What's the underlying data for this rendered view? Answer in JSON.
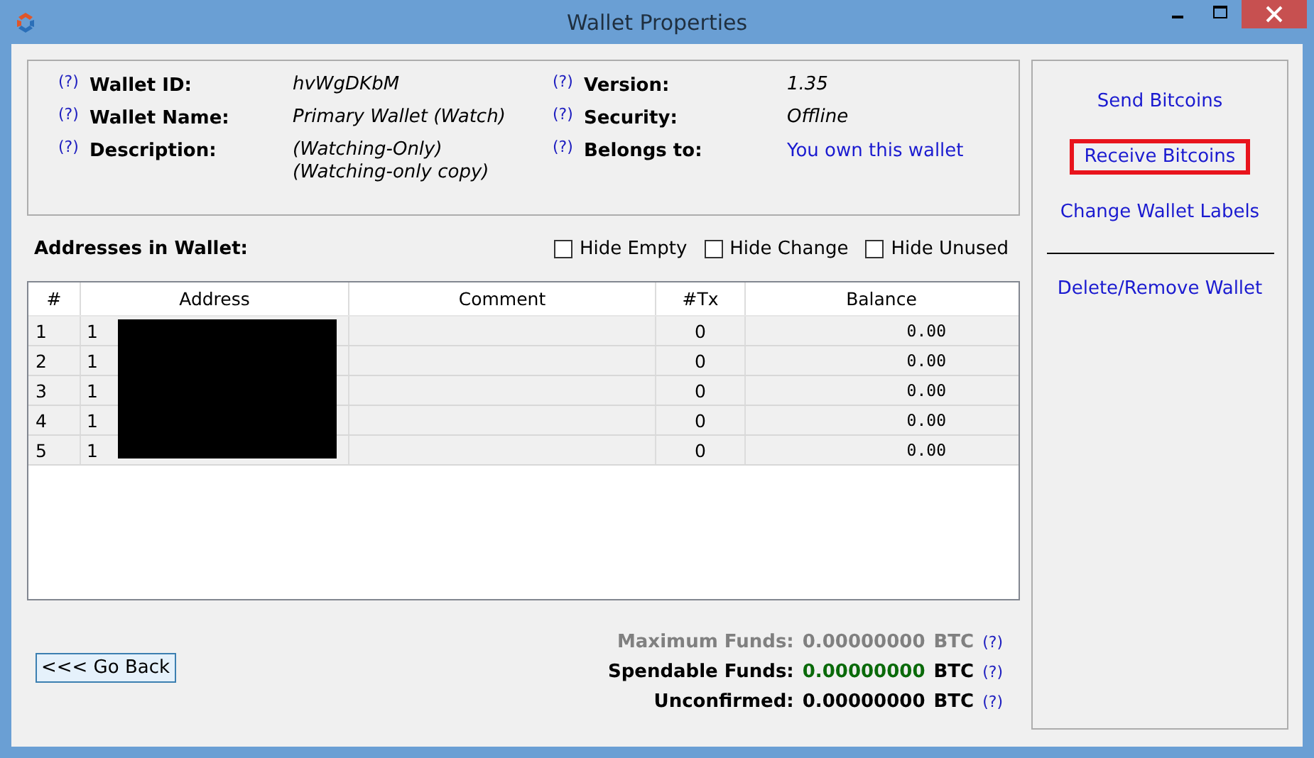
{
  "window": {
    "title": "Wallet Properties"
  },
  "info": {
    "left": [
      {
        "label": "Wallet ID:",
        "value": "hvWgDKbM",
        "help": "(?)"
      },
      {
        "label": "Wallet Name:",
        "value": "Primary Wallet (Watch)",
        "help": "(?)"
      },
      {
        "label": "Description:",
        "value": "(Watching-Only)\n(Watching-only copy)",
        "help": "(?)"
      }
    ],
    "right": [
      {
        "label": "Version:",
        "value": "1.35",
        "help": "(?)",
        "kind": "text"
      },
      {
        "label": "Security:",
        "value": "Offline",
        "help": "(?)",
        "kind": "text"
      },
      {
        "label": "Belongs to:",
        "value": "You own this wallet",
        "help": "(?)",
        "kind": "link"
      }
    ]
  },
  "addresses": {
    "title": "Addresses in Wallet:",
    "filters": [
      {
        "label": "Hide Empty",
        "checked": false
      },
      {
        "label": "Hide Change",
        "checked": false
      },
      {
        "label": "Hide Unused",
        "checked": false
      }
    ],
    "table": {
      "columns": [
        "#",
        "Address",
        "Comment",
        "#Tx",
        "Balance"
      ],
      "rows": [
        [
          "1",
          "1",
          "",
          "0",
          "0.00"
        ],
        [
          "2",
          "1",
          "",
          "0",
          "0.00"
        ],
        [
          "3",
          "1",
          "",
          "0",
          "0.00"
        ],
        [
          "4",
          "1",
          "",
          "0",
          "0.00"
        ],
        [
          "5",
          "1",
          "",
          "0",
          "0.00"
        ]
      ]
    }
  },
  "funds": [
    {
      "label": "Maximum Funds:",
      "amount": "0.00000000",
      "unit": "BTC",
      "help": "(?)",
      "kind": "muted"
    },
    {
      "label": "Spendable Funds:",
      "amount": "0.00000000",
      "unit": "BTC",
      "help": "(?)",
      "kind": "spendable"
    },
    {
      "label": "Unconfirmed:",
      "amount": "0.00000000",
      "unit": "BTC",
      "help": "(?)",
      "kind": "normal"
    }
  ],
  "back_button": "<<< Go Back",
  "actions": [
    {
      "label": "Send Bitcoins",
      "highlighted": false,
      "separated": false
    },
    {
      "label": "Receive Bitcoins",
      "highlighted": true,
      "separated": false
    },
    {
      "label": "Change Wallet Labels",
      "highlighted": false,
      "separated": false
    },
    {
      "label": "Delete/Remove Wallet",
      "highlighted": false,
      "separated": true
    }
  ]
}
